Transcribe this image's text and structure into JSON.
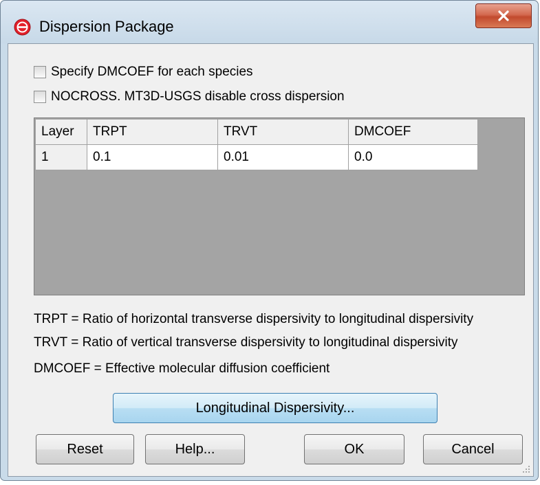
{
  "window": {
    "title": "Dispersion Package",
    "close_icon": "close-icon"
  },
  "options": {
    "specify_dmcoef": {
      "label": "Specify DMCOEF for each species",
      "checked": false
    },
    "nocross": {
      "label": "NOCROSS. MT3D-USGS disable cross dispersion",
      "checked": false
    }
  },
  "table": {
    "columns": [
      "Layer",
      "TRPT",
      "TRVT",
      "DMCOEF"
    ],
    "rows": [
      [
        "1",
        "0.1",
        "0.01",
        "0.0"
      ]
    ]
  },
  "descriptions": [
    "TRPT = Ratio of horizontal transverse dispersivity to longitudinal dispersivity",
    "TRVT = Ratio of vertical transverse dispersivity to longitudinal dispersivity",
    "DMCOEF = Effective molecular diffusion coefficient"
  ],
  "buttons": {
    "longitudinal": "Longitudinal Dispersivity...",
    "reset": "Reset",
    "help": "Help...",
    "ok": "OK",
    "cancel": "Cancel"
  }
}
